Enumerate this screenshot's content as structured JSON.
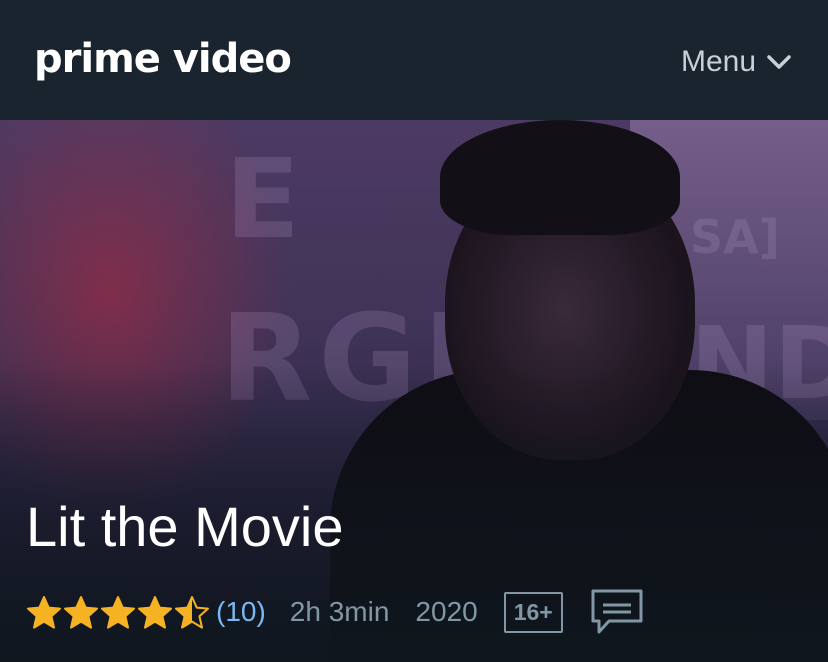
{
  "header": {
    "brand": "prime video",
    "menu_label": "Menu"
  },
  "movie": {
    "title": "Lit the Movie",
    "rating": 4.5,
    "rating_max": 5,
    "rating_count": "(10)",
    "duration": "2h 3min",
    "year": "2020",
    "age_rating": "16+"
  },
  "icons": {
    "menu": "chevron-down-icon",
    "stars": "star-icon",
    "subtitles": "subtitles-icon"
  },
  "colors": {
    "star": "#f5b324",
    "link": "#79b8f3",
    "muted": "#8197a4",
    "topbar": "#1a242f"
  }
}
